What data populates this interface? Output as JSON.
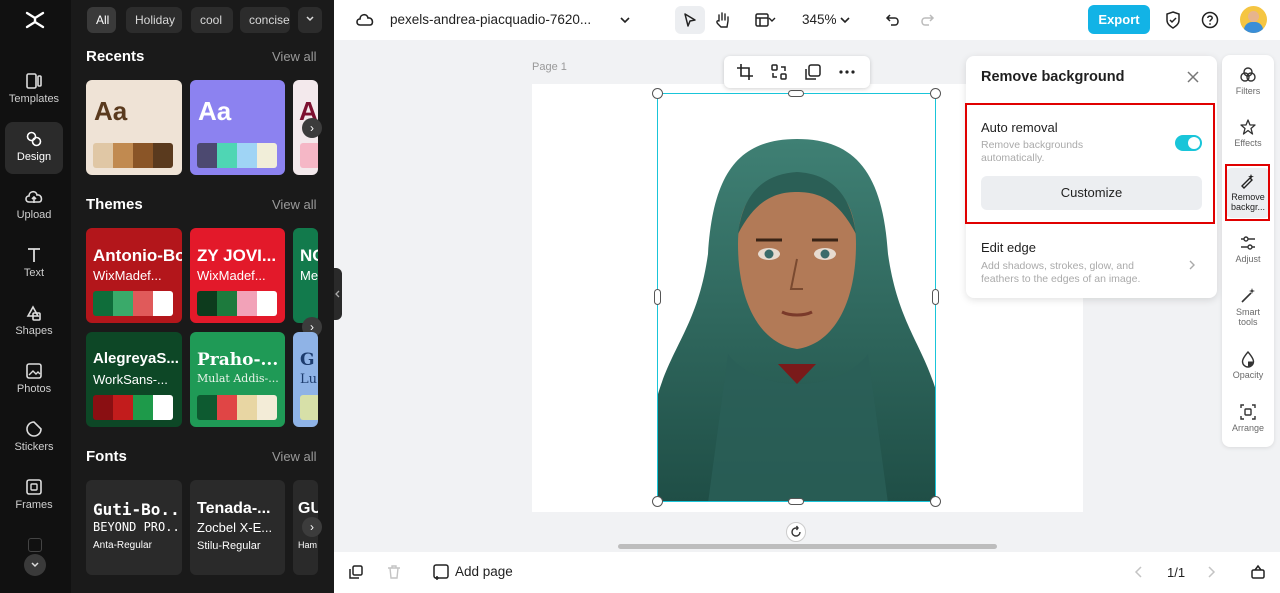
{
  "rail": {
    "items": [
      {
        "label": "Templates"
      },
      {
        "label": "Design"
      },
      {
        "label": "Upload"
      },
      {
        "label": "Text"
      },
      {
        "label": "Shapes"
      },
      {
        "label": "Photos"
      },
      {
        "label": "Stickers"
      },
      {
        "label": "Frames"
      }
    ]
  },
  "library": {
    "filter_chips": [
      "All",
      "Holiday",
      "cool",
      "concise"
    ],
    "recents": {
      "title": "Recents",
      "view_all": "View all",
      "cards": [
        {
          "sample": "Aa",
          "bg": "#efe3d6",
          "fg": "#5a3a1e",
          "swatches": [
            "#e0c7a5",
            "#c18a50",
            "#8a5527",
            "#5a3a1e"
          ]
        },
        {
          "sample": "Aa",
          "bg": "#8c82f0",
          "fg": "#ffffff",
          "swatches": [
            "#4c4970",
            "#4fd6b4",
            "#9fd4f5",
            "#f1eed9"
          ]
        },
        {
          "sample": "A",
          "bg": "#f3e9ec",
          "fg": "#7d1030",
          "swatches": [
            "#f5b7c6"
          ]
        }
      ]
    },
    "themes": {
      "title": "Themes",
      "view_all": "View all",
      "cards": [
        {
          "heading": "Antonio-Bold",
          "sub": "WixMadef...",
          "bg": "#b3161b",
          "swatches": [
            "#0f6d3a",
            "#3aaa6a",
            "#e05a5a",
            "#ffffff"
          ]
        },
        {
          "heading": "ZY JOVI...",
          "sub": "WixMadef...",
          "bg": "#e3192a",
          "swatches": [
            "#0d3b1d",
            "#1d7a3d",
            "#f2a2b8",
            "#ffffff"
          ]
        },
        {
          "heading": "NC",
          "sub": "Me",
          "bg": "#127a4c",
          "swatches": []
        },
        {
          "heading": "AlegreyaS...",
          "sub": "WorkSans-...",
          "bg": "#0d4726",
          "swatches": [
            "#8a0f12",
            "#c21c1c",
            "#1e9a4a",
            "#ffffff"
          ]
        },
        {
          "heading": "Praho-...",
          "sub": "Mulat Addis-...",
          "bg": "#1f9a56",
          "swatches": [
            "#0d5a30",
            "#e04545",
            "#e8d6a3",
            "#f3ecd7"
          ]
        },
        {
          "heading": "G",
          "sub": "Lu",
          "bg": "#8fb3e6",
          "swatches": [
            "#d7e0a8"
          ]
        }
      ]
    },
    "fonts": {
      "title": "Fonts",
      "view_all": "View all",
      "cards": [
        {
          "l1": "Guti-Bo...",
          "l2": "BEYOND PRO...",
          "l3": "Anta-Regular"
        },
        {
          "l1": "Tenada-...",
          "l2": "Zocbel X-E...",
          "l3": "Stilu-Regular"
        },
        {
          "l1": "GU",
          "l2": "",
          "l3": "Ham"
        }
      ]
    }
  },
  "topbar": {
    "filename": "pexels-andrea-piacquadio-7620...",
    "zoom": "345%",
    "export_label": "Export"
  },
  "canvas": {
    "page_label": "Page 1"
  },
  "remove_bg": {
    "title": "Remove background",
    "auto_title": "Auto removal",
    "auto_desc": "Remove backgrounds automatically.",
    "auto_enabled": true,
    "customize_label": "Customize",
    "edge_title": "Edit edge",
    "edge_desc": "Add shadows, strokes, glow, and feathers to the edges of an image."
  },
  "tools": {
    "items": [
      {
        "label": "Filters"
      },
      {
        "label": "Effects"
      },
      {
        "label": "Remove backgr..."
      },
      {
        "label": "Adjust"
      },
      {
        "label": "Smart tools"
      },
      {
        "label": "Opacity"
      },
      {
        "label": "Arrange"
      }
    ]
  },
  "bottombar": {
    "add_page": "Add page",
    "page_counter": "1/1"
  },
  "colors": {
    "accent": "#12b3e6",
    "highlight": "#e00000",
    "selection": "#19c5d9",
    "toggle_on": "#19c5d9"
  }
}
